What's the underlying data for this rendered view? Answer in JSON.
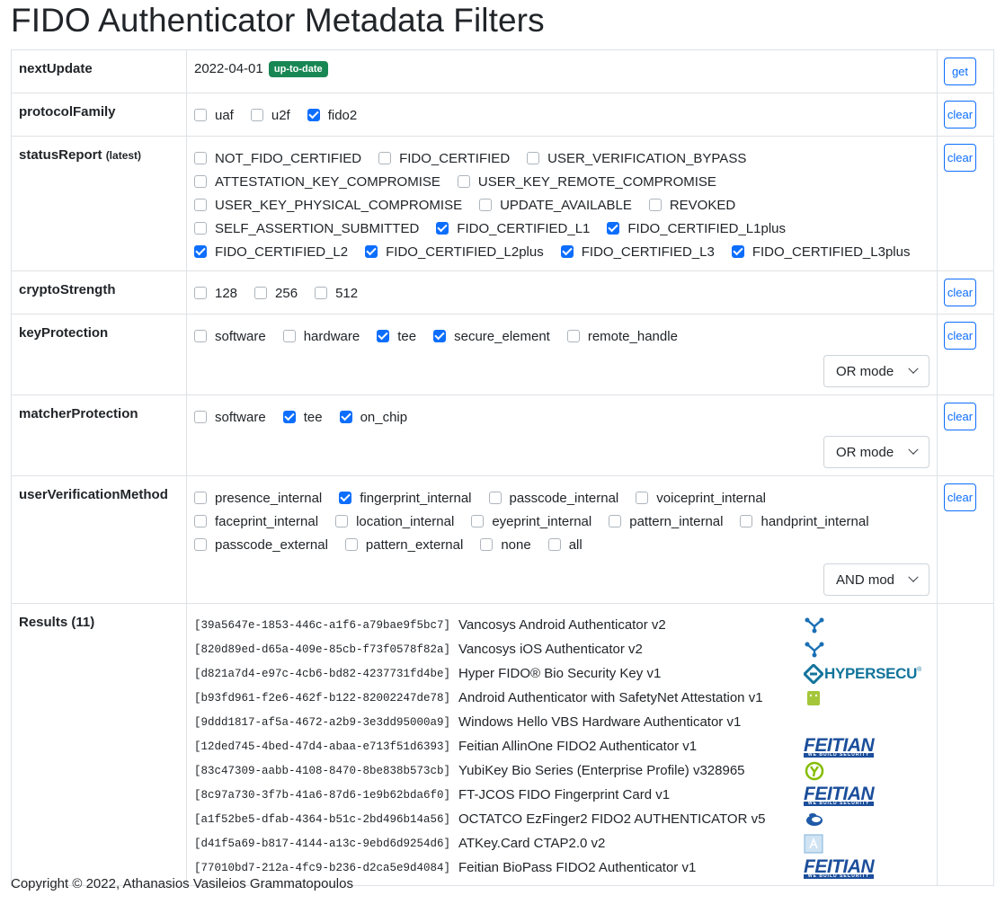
{
  "title": "FIDO Authenticator Metadata Filters",
  "rows": {
    "nextUpdate": {
      "label": "nextUpdate",
      "date": "2022-04-01",
      "badge": "up-to-date",
      "button": "get"
    },
    "protocolFamily": {
      "label": "protocolFamily",
      "button": "clear",
      "options": [
        {
          "label": "uaf",
          "checked": false
        },
        {
          "label": "u2f",
          "checked": false
        },
        {
          "label": "fido2",
          "checked": true
        }
      ]
    },
    "statusReport": {
      "label": "statusReport",
      "label_note": "(latest)",
      "button": "clear",
      "lines": [
        [
          {
            "label": "NOT_FIDO_CERTIFIED",
            "checked": false
          },
          {
            "label": "FIDO_CERTIFIED",
            "checked": false
          },
          {
            "label": "USER_VERIFICATION_BYPASS",
            "checked": false
          }
        ],
        [
          {
            "label": "ATTESTATION_KEY_COMPROMISE",
            "checked": false
          },
          {
            "label": "USER_KEY_REMOTE_COMPROMISE",
            "checked": false
          }
        ],
        [
          {
            "label": "USER_KEY_PHYSICAL_COMPROMISE",
            "checked": false
          },
          {
            "label": "UPDATE_AVAILABLE",
            "checked": false
          },
          {
            "label": "REVOKED",
            "checked": false
          }
        ],
        [
          {
            "label": "SELF_ASSERTION_SUBMITTED",
            "checked": false
          },
          {
            "label": "FIDO_CERTIFIED_L1",
            "checked": true
          },
          {
            "label": "FIDO_CERTIFIED_L1plus",
            "checked": true
          }
        ],
        [
          {
            "label": "FIDO_CERTIFIED_L2",
            "checked": true
          },
          {
            "label": "FIDO_CERTIFIED_L2plus",
            "checked": true
          },
          {
            "label": "FIDO_CERTIFIED_L3",
            "checked": true
          },
          {
            "label": "FIDO_CERTIFIED_L3plus",
            "checked": true
          }
        ]
      ]
    },
    "cryptoStrength": {
      "label": "cryptoStrength",
      "button": "clear",
      "options": [
        {
          "label": "128",
          "checked": false
        },
        {
          "label": "256",
          "checked": false
        },
        {
          "label": "512",
          "checked": false
        }
      ]
    },
    "keyProtection": {
      "label": "keyProtection",
      "button": "clear",
      "mode": "OR mode",
      "options": [
        {
          "label": "software",
          "checked": false
        },
        {
          "label": "hardware",
          "checked": false
        },
        {
          "label": "tee",
          "checked": true
        },
        {
          "label": "secure_element",
          "checked": true
        },
        {
          "label": "remote_handle",
          "checked": false
        }
      ]
    },
    "matcherProtection": {
      "label": "matcherProtection",
      "button": "clear",
      "mode": "OR mode",
      "options": [
        {
          "label": "software",
          "checked": false
        },
        {
          "label": "tee",
          "checked": true
        },
        {
          "label": "on_chip",
          "checked": true
        }
      ]
    },
    "userVerificationMethod": {
      "label": "userVerificationMethod",
      "button": "clear",
      "mode": "AND mod",
      "lines": [
        [
          {
            "label": "presence_internal",
            "checked": false
          },
          {
            "label": "fingerprint_internal",
            "checked": true
          },
          {
            "label": "passcode_internal",
            "checked": false
          },
          {
            "label": "voiceprint_internal",
            "checked": false
          }
        ],
        [
          {
            "label": "faceprint_internal",
            "checked": false
          },
          {
            "label": "location_internal",
            "checked": false
          },
          {
            "label": "eyeprint_internal",
            "checked": false
          },
          {
            "label": "pattern_internal",
            "checked": false
          },
          {
            "label": "handprint_internal",
            "checked": false
          }
        ],
        [
          {
            "label": "passcode_external",
            "checked": false
          },
          {
            "label": "pattern_external",
            "checked": false
          },
          {
            "label": "none",
            "checked": false
          },
          {
            "label": "all",
            "checked": false
          }
        ]
      ]
    }
  },
  "results": {
    "label": "Results (11)",
    "items": [
      {
        "id": "[39a5647e-1853-446c-a1f6-a79bae9f5bc7]",
        "name": "Vancosys Android Authenticator v2",
        "icon": "vancosys-logo"
      },
      {
        "id": "[820d89ed-d65a-409e-85cb-f73f0578f82a]",
        "name": "Vancosys iOS Authenticator v2",
        "icon": "vancosys-logo"
      },
      {
        "id": "[d821a7d4-e97c-4cb6-bd82-4237731fd4be]",
        "name": "Hyper FIDO® Bio Security Key v1",
        "icon": "hypersecu-logo",
        "icon_text": "HYPERSECU"
      },
      {
        "id": "[b93fd961-f2e6-462f-b122-82002247de78]",
        "name": "Android Authenticator with SafetyNet Attestation v1",
        "icon": "android-logo"
      },
      {
        "id": "[9ddd1817-af5a-4672-a2b9-3e3dd95000a9]",
        "name": "Windows Hello VBS Hardware Authenticator v1",
        "icon": "none"
      },
      {
        "id": "[12ded745-4bed-47d4-abaa-e713f51d6393]",
        "name": "Feitian AllinOne FIDO2 Authenticator v1",
        "icon": "feitian-logo",
        "icon_text": "FEITIAN",
        "icon_sub": "WE BUILD SECURITY"
      },
      {
        "id": "[83c47309-aabb-4108-8470-8be838b573cb]",
        "name": "YubiKey Bio Series (Enterprise Profile) v328965",
        "icon": "yubico-logo"
      },
      {
        "id": "[8c97a730-3f7b-41a6-87d6-1e9b62bda6f0]",
        "name": "FT-JCOS FIDO Fingerprint Card v1",
        "icon": "feitian-logo",
        "icon_text": "FEITIAN",
        "icon_sub": "WE BUILD SECURITY"
      },
      {
        "id": "[a1f52be5-dfab-4364-b51c-2bd496b14a56]",
        "name": "OCTATCO EzFinger2 FIDO2 AUTHENTICATOR v5",
        "icon": "octatco-logo"
      },
      {
        "id": "[d41f5a69-b817-4144-a13c-9ebd6d9254d6]",
        "name": "ATKey.Card CTAP2.0 v2",
        "icon": "atkey-logo"
      },
      {
        "id": "[77010bd7-212a-4fc9-b236-d2ca5e9d4084]",
        "name": "Feitian BioPass FIDO2 Authenticator v1",
        "icon": "feitian-logo",
        "icon_text": "FEITIAN",
        "icon_sub": "WE BUILD SECURITY"
      }
    ]
  },
  "colors": {
    "accent": "#0d6efd",
    "badge": "#198754",
    "border": "#dee2e6",
    "feitian": "#1b4e9b",
    "hypersecu": "#12749b"
  },
  "footer": "Copyright © 2022, Athanasios Vasileios Grammatopoulos"
}
